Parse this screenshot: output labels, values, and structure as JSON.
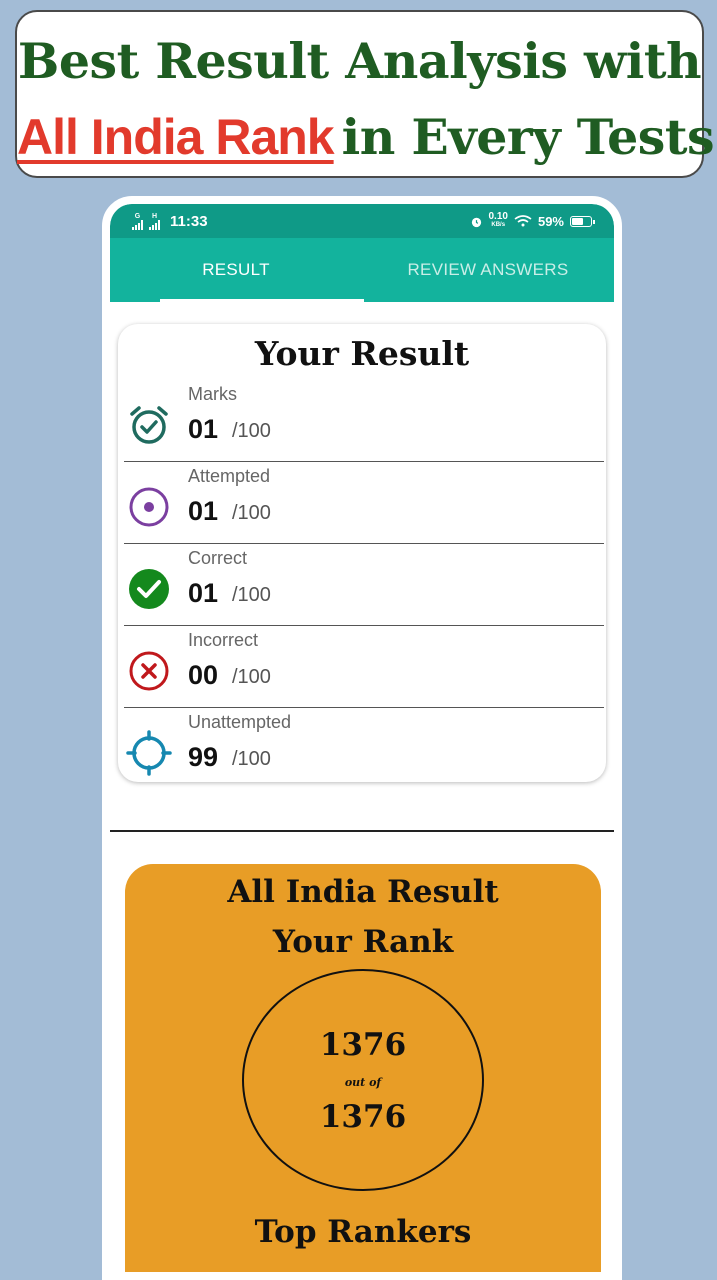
{
  "banner": {
    "line1": "Best Result Analysis with",
    "highlight": "All India Rank",
    "line2_rest": "in Every Tests"
  },
  "status_bar": {
    "network1": "G",
    "network2": "H",
    "time": "11:33",
    "net_speed": "0.10",
    "net_speed_unit": "KB/s",
    "battery": "59%"
  },
  "tabs": [
    {
      "label": "RESULT",
      "active": true
    },
    {
      "label": "REVIEW ANSWERS",
      "active": false
    }
  ],
  "result": {
    "title": "Your Result",
    "rows": [
      {
        "label": "Marks",
        "value": "01",
        "total": "/100",
        "icon": "alarm-check-icon",
        "color": "#1f6b5f"
      },
      {
        "label": "Attempted",
        "value": "01",
        "total": "/100",
        "icon": "radio-dot-icon",
        "color": "#7b3fa0"
      },
      {
        "label": "Correct",
        "value": "01",
        "total": "/100",
        "icon": "check-circle-icon",
        "color": "#14891d"
      },
      {
        "label": "Incorrect",
        "value": "00",
        "total": "/100",
        "icon": "x-circle-icon",
        "color": "#c0181c"
      },
      {
        "label": "Unattempted",
        "value": "99",
        "total": "/100",
        "icon": "crosshair-icon",
        "color": "#1688b0"
      }
    ]
  },
  "rank": {
    "title": "All India Result",
    "subtitle": "Your Rank",
    "rank": "1376",
    "out_of_label": "out of",
    "total": "1376",
    "top_rankers": "Top Rankers",
    "card_color": "#e89d26"
  },
  "colors": {
    "background": "#a3bcd6",
    "status_bar": "#0f9a87",
    "tab_bar": "#13b39d",
    "banner_text": "#1f5c22",
    "banner_highlight": "#e23a2c"
  }
}
